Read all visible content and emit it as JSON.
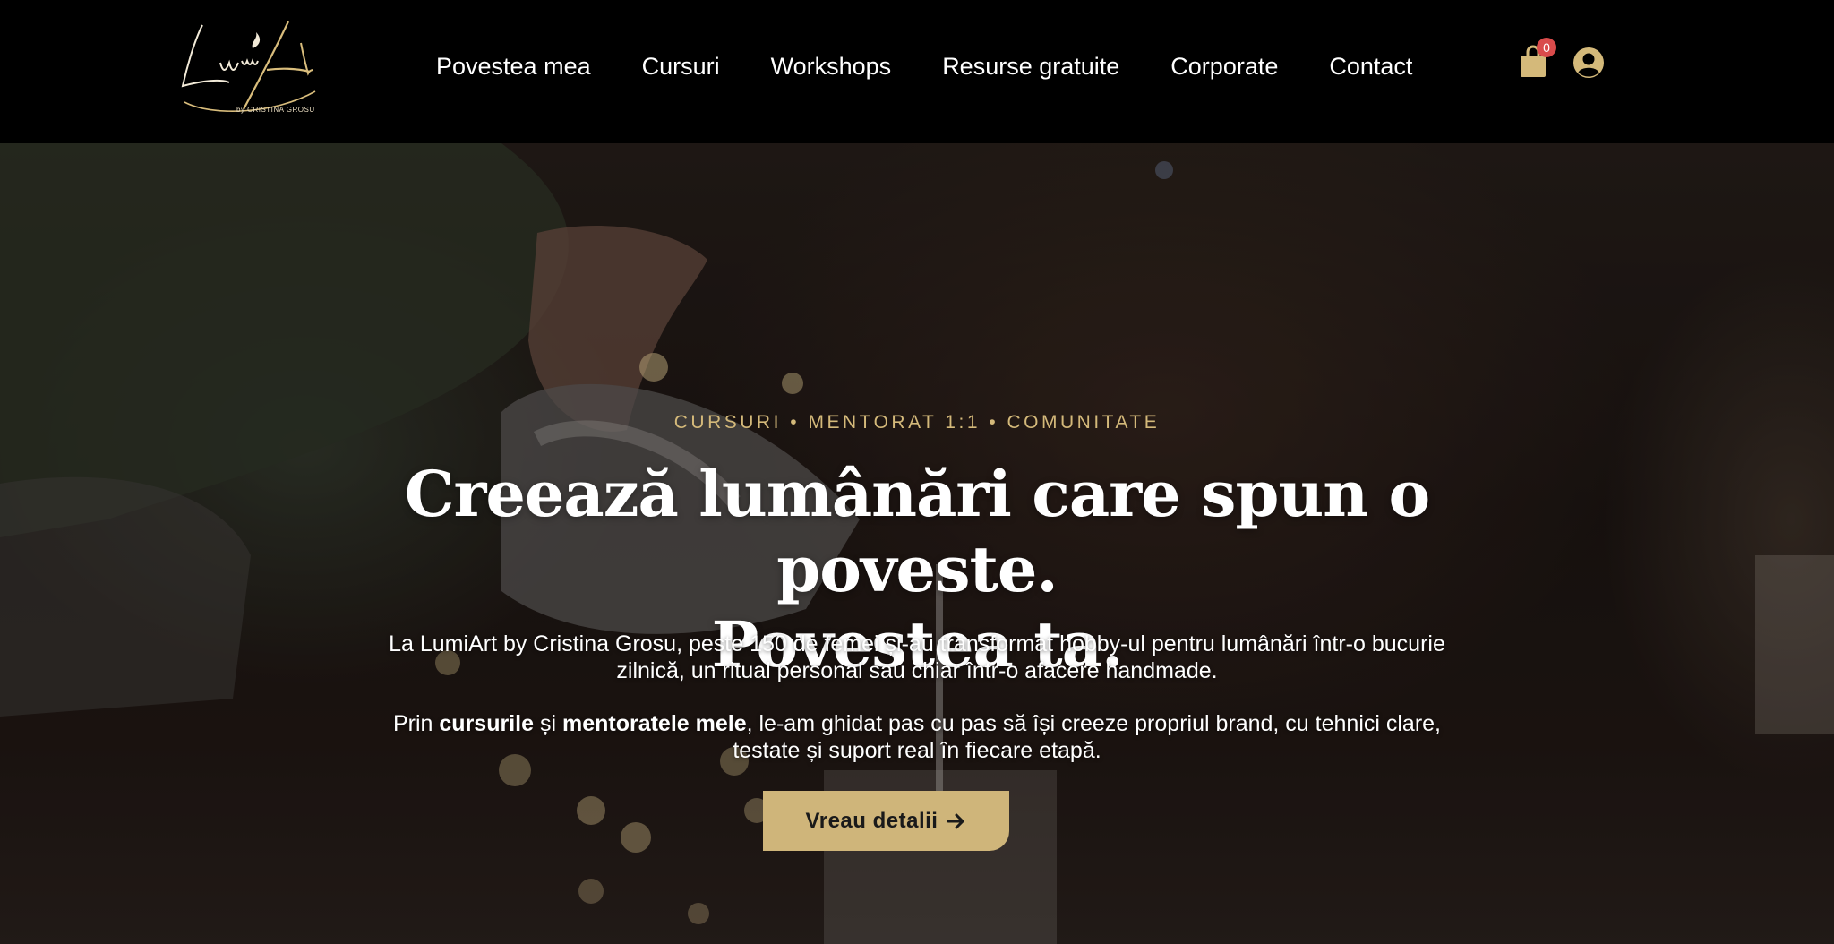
{
  "brand": {
    "logo_text": "LumiArt",
    "logo_caption": "by CRISTINA GROSU",
    "accent_color": "#cfb57a"
  },
  "nav": {
    "items": [
      {
        "label": "Povestea mea"
      },
      {
        "label": "Cursuri"
      },
      {
        "label": "Workshops"
      },
      {
        "label": "Resurse gratuite"
      },
      {
        "label": "Corporate"
      },
      {
        "label": "Contact"
      }
    ]
  },
  "header": {
    "cart_icon": "shopping-bag-icon",
    "cart_count": "0",
    "account_icon": "user-circle-icon"
  },
  "hero": {
    "eyebrow": "CURSURI • MENTORAT 1:1 • COMUNITATE",
    "title_line_1": "Creează lumânări care spun o poveste.",
    "title_line_2": "Povestea ta.",
    "paragraph_1": "La LumiArt by Cristina Grosu, peste 150 de femei și-au transformat hobby-ul pentru lumânări într-o bucurie zilnică, un ritual personal sau chiar într-o afacere handmade.",
    "paragraph_2_prefix": "Prin ",
    "paragraph_2_bold_1": "cursurile",
    "paragraph_2_mid": " și ",
    "paragraph_2_bold_2": "mentoratele mele",
    "paragraph_2_suffix": ", le-am ghidat pas cu pas să își creeze propriul brand, cu tehnici clare, testate și suport real în fiecare etapă.",
    "cta_label": "Vreau detalii",
    "cta_icon": "arrow-right-icon"
  }
}
